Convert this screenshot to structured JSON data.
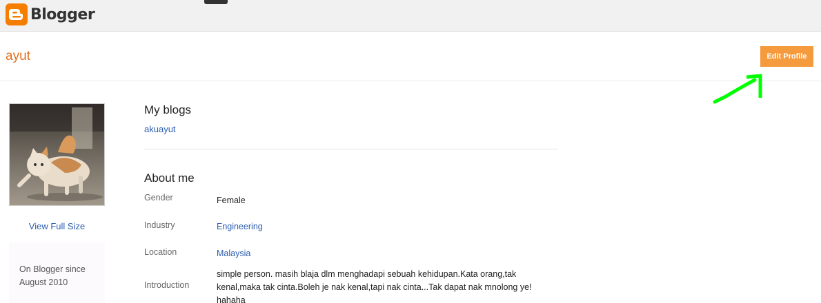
{
  "app": {
    "brand": "Blogger",
    "accent": "#f57d00",
    "link_color": "#2a5db0"
  },
  "profile": {
    "name": "ayut",
    "edit_label": "Edit Profile",
    "view_full_label": "View Full Size",
    "since_line1": "On Blogger since",
    "since_line2": "August 2010"
  },
  "blogs": {
    "title": "My blogs",
    "items": [
      "akuayut"
    ]
  },
  "about": {
    "title": "About me",
    "rows": [
      {
        "label": "Gender",
        "value": "Female"
      },
      {
        "label": "Industry",
        "value": "Engineering"
      },
      {
        "label": "Location",
        "value": "Malaysia"
      },
      {
        "label": "Introduction",
        "value": "simple person. masih blaja dlm menghadapi sebuah kehidupan.Kata orang,tak kenal,maka tak cinta.Boleh je nak kenal,tapi nak cinta...Tak dapat nak mnolong ye! hahaha"
      }
    ]
  },
  "annotation": {
    "arrow_color": "#00ff00"
  }
}
